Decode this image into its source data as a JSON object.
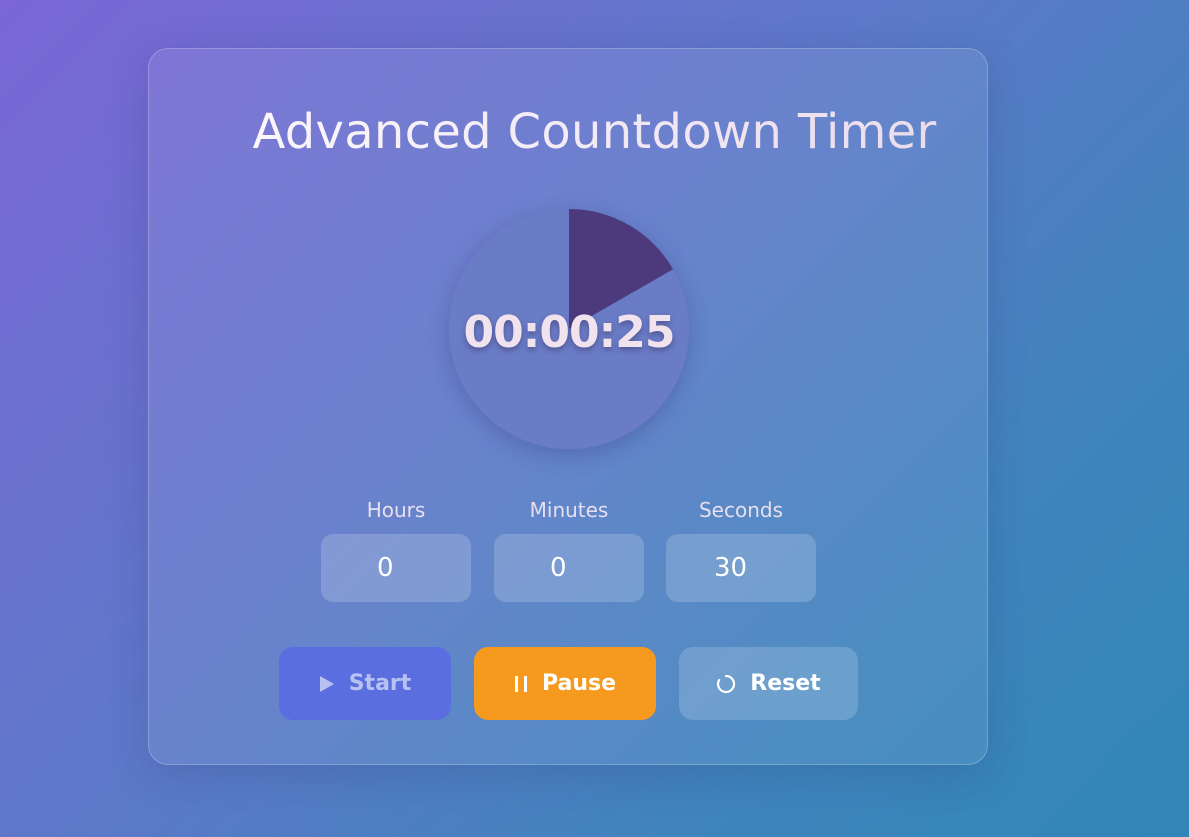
{
  "app": {
    "title": "Advanced Countdown Timer"
  },
  "timer": {
    "display": "00:00:25",
    "progress_fraction": 0.167,
    "remaining_seconds": 25,
    "total_seconds": 30
  },
  "inputs": [
    {
      "label": "Hours",
      "value": "0"
    },
    {
      "label": "Minutes",
      "value": "0"
    },
    {
      "label": "Seconds",
      "value": "30"
    }
  ],
  "buttons": {
    "start": {
      "label": "Start",
      "icon": "play-icon",
      "disabled": true
    },
    "pause": {
      "label": "Pause",
      "icon": "pause-icon"
    },
    "reset": {
      "label": "Reset",
      "icon": "reset-icon"
    }
  },
  "colors": {
    "dial_face": "#6a7cc6",
    "dial_progress": "#4d3a7c",
    "start_bg": "#5a6ee0",
    "pause_bg": "#f6991f",
    "reset_bg": "rgba(255,255,255,0.17)"
  }
}
